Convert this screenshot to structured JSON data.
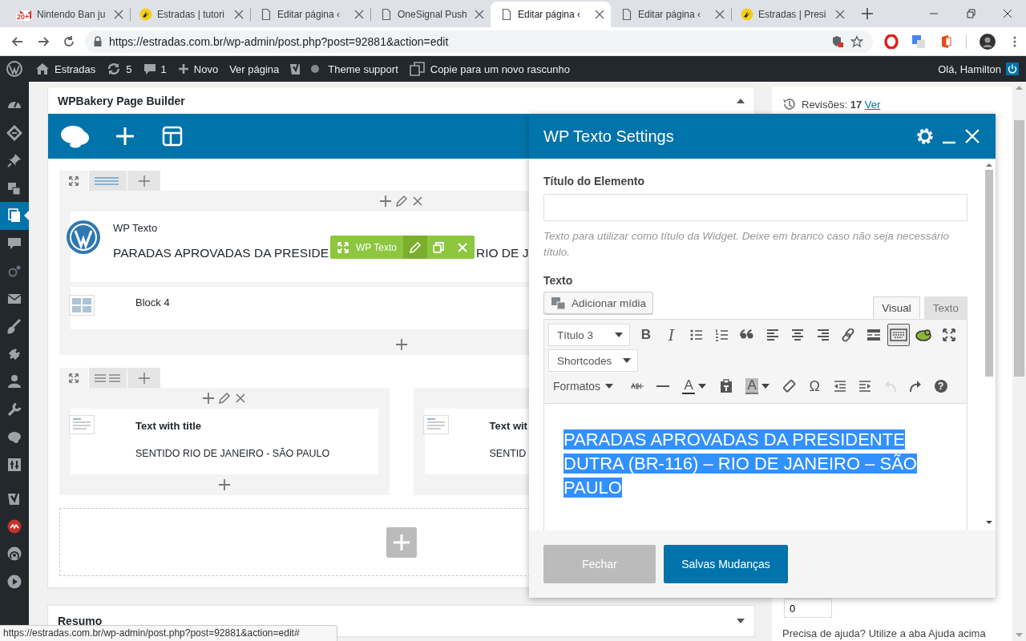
{
  "browser": {
    "tabs": [
      {
        "title": "Nintendo Ban ju",
        "kind": "mail",
        "badge": "20+",
        "selected": false
      },
      {
        "title": "Estradas | tutori",
        "kind": "site",
        "selected": false
      },
      {
        "title": "Editar página ‹",
        "kind": "page",
        "selected": false
      },
      {
        "title": "OneSignal Push",
        "kind": "page",
        "selected": false
      },
      {
        "title": "Editar página ‹",
        "kind": "page",
        "selected": true
      },
      {
        "title": "Editar página ‹",
        "kind": "page",
        "selected": false
      },
      {
        "title": "Estradas | Presi",
        "kind": "site",
        "selected": false
      }
    ],
    "url": "https://estradas.com.br/wp-admin/post.php?post=92881&action=edit"
  },
  "admin_bar": {
    "site": "Estradas",
    "updates": "5",
    "comments": "1",
    "new": "Novo",
    "view": "Ver página",
    "theme_support": "Theme support",
    "copy_draft": "Copie para um novo rascunho",
    "greeting": "Olá, Hamilton"
  },
  "admin_menu": [
    {
      "selected": false
    },
    {
      "selected": false
    },
    {
      "selected": false
    },
    {
      "selected": false
    },
    {
      "selected": true
    },
    {
      "selected": false
    },
    {
      "selected": false
    },
    {
      "selected": false
    },
    {
      "selected": false
    },
    {
      "selected": false
    },
    {
      "selected": false
    },
    {
      "selected": false
    },
    {
      "selected": false
    },
    {
      "selected": false
    },
    {
      "selected": false
    },
    {
      "selected": false
    },
    {
      "selected": false
    },
    {
      "selected": false
    }
  ],
  "builder": {
    "title": "WPBakery Page Builder",
    "rows": [
      {
        "highlighted": true,
        "columns": [
          {
            "elements": [
              {
                "kind": "text",
                "title": "WP Texto",
                "content": "PARADAS APROVADAS DA PRESIDE",
                "content_tail": "RIO DE J",
                "toolbar": {
                  "label": "WP Texto"
                }
              },
              {
                "kind": "block",
                "title": "Block 4"
              }
            ]
          }
        ]
      },
      {
        "highlighted": false,
        "columns": [
          {
            "elements": [
              {
                "kind": "titled_text",
                "title": "Text with title",
                "content": "SENTIDO RIO DE JANEIRO - SÃO PAULO"
              }
            ]
          },
          {
            "elements": [
              {
                "kind": "titled_text",
                "title": "Text wit",
                "content": "SENTID"
              }
            ]
          }
        ]
      }
    ]
  },
  "summary": {
    "title": "Resumo"
  },
  "sidebar": {
    "revisions": "Revisões: **17**",
    "revisions_link": "Ver",
    "order": "0",
    "help": "Precisa de ajuda? Utilize a aba Ajuda acima"
  },
  "dialog": {
    "title": "WP Texto Settings",
    "title_label": "Título do Elemento",
    "title_help": "Texto para utilizar como título da Widget. Deixe em branco caso não seja necessário título.",
    "text_label": "Texto",
    "add_media": "Adicionar mídia",
    "editor_tabs": [
      {
        "label": "Visual",
        "selected": true
      },
      {
        "label": "Texto",
        "selected": false
      }
    ],
    "toolbar": [
      [
        {
          "kind": "select",
          "label": "Título 3"
        },
        {
          "kind": "bold",
          "glyph": "B",
          "active": false,
          "disabled": false
        },
        {
          "kind": "italic",
          "glyph": "I",
          "active": false,
          "disabled": false
        },
        {
          "kind": "bullet_list",
          "active": false,
          "disabled": false
        },
        {
          "kind": "number_list",
          "active": false,
          "disabled": false
        },
        {
          "kind": "quote",
          "active": false,
          "disabled": false
        },
        {
          "kind": "align_left",
          "active": false,
          "disabled": false
        },
        {
          "kind": "align_center",
          "active": false,
          "disabled": false
        },
        {
          "kind": "align_right",
          "active": false,
          "disabled": false
        },
        {
          "kind": "link",
          "active": false,
          "disabled": false
        },
        {
          "kind": "read_more",
          "active": false,
          "disabled": false
        },
        {
          "kind": "toolbar_toggle",
          "active": true,
          "disabled": false
        },
        {
          "kind": "plugin",
          "active": false,
          "disabled": false
        },
        {
          "kind": "fullscreen",
          "active": false,
          "disabled": false
        }
      ],
      [
        {
          "kind": "select",
          "label": "Shortcodes"
        }
      ],
      [
        {
          "kind": "menu",
          "label": "Formatos"
        },
        {
          "kind": "strikethrough",
          "active": false,
          "disabled": false
        },
        {
          "kind": "hr",
          "active": false,
          "disabled": false
        },
        {
          "kind": "text_color",
          "glyph": "A",
          "active": false,
          "disabled": false
        },
        {
          "kind": "paste_text",
          "active": false,
          "disabled": false
        },
        {
          "kind": "bg_color",
          "glyph": "A",
          "active": false,
          "disabled": false
        },
        {
          "kind": "clear_format",
          "active": false,
          "disabled": false
        },
        {
          "kind": "charmap",
          "glyph": "Ω",
          "active": false,
          "disabled": false
        },
        {
          "kind": "outdent",
          "active": false,
          "disabled": false
        },
        {
          "kind": "indent",
          "active": false,
          "disabled": false
        },
        {
          "kind": "undo",
          "active": false,
          "disabled": true
        },
        {
          "kind": "redo",
          "active": false,
          "disabled": false
        },
        {
          "kind": "help",
          "glyph": "?",
          "active": false,
          "disabled": false
        }
      ]
    ],
    "content": "PARADAS APROVADAS DA PRESIDENTE DUTRA (BR-116) – RIO DE JANEIRO – SÃO PAULO",
    "content_selected": true,
    "buttons": [
      {
        "label": "Fechar",
        "kind": "secondary"
      },
      {
        "label": "Salvas Mudanças",
        "kind": "primary"
      }
    ]
  },
  "status_url": "https://estradas.com.br/wp-admin/post.php?post=92881&action=edit#"
}
